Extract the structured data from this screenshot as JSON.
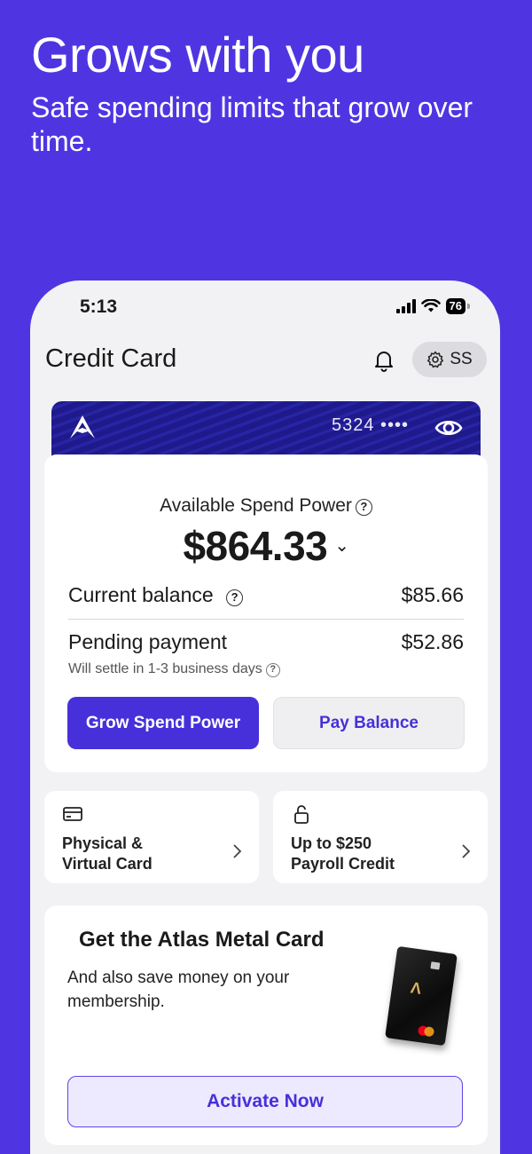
{
  "hero": {
    "title": "Grows with you",
    "subtitle": "Safe spending limits that grow over time."
  },
  "status_bar": {
    "time": "5:13",
    "battery": "76"
  },
  "app_bar": {
    "title": "Credit Card",
    "profile_initials": "SS"
  },
  "card": {
    "number_masked": "5324 ••••"
  },
  "balance": {
    "available_label": "Available Spend Power",
    "available_amount": "$864.33",
    "current_label": "Current balance",
    "current_value": "$85.66",
    "pending_label": "Pending payment",
    "pending_value": "$52.86",
    "settle_note": "Will settle in 1-3 business days",
    "grow_button": "Grow Spend Power",
    "pay_button": "Pay Balance"
  },
  "tiles": [
    {
      "line1": "Physical &",
      "line2": "Virtual Card",
      "icon": "credit-card-icon"
    },
    {
      "line1": "Up to $250",
      "line2": "Payroll Credit",
      "icon": "lock-icon"
    }
  ],
  "promo": {
    "title": "Get the Atlas Metal Card",
    "description": "And also save money on your membership.",
    "activate_button": "Activate Now"
  },
  "colors": {
    "brand": "#4F35E2",
    "primary_button": "#4730D9",
    "card_navy": "#1E1A8C"
  }
}
